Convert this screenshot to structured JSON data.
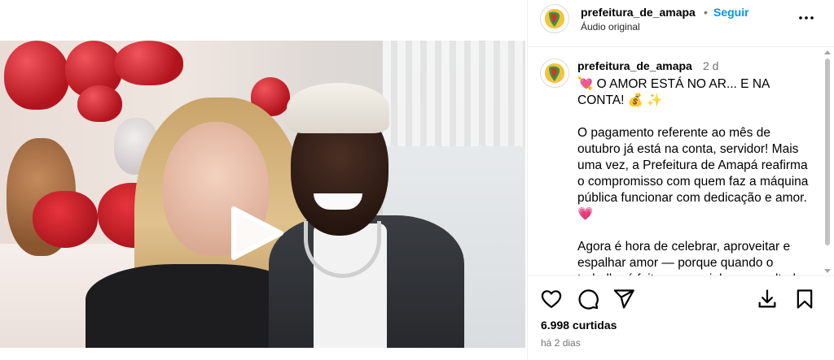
{
  "post": {
    "username": "prefeitura_de_amapa",
    "follow_label": "Seguir",
    "dot_separator": "•",
    "audio_label": "Áudio original"
  },
  "caption": {
    "username": "prefeitura_de_amapa",
    "time_ago": "2 d",
    "paragraphs": [
      "💘 O AMOR ESTÁ NO AR... E NA CONTA! 💰 ✨",
      "O pagamento referente ao mês de outubro já está na conta, servidor! Mais uma vez, a Prefeitura de Amapá reafirma o compromisso com quem faz a máquina pública funcionar com dedicação e amor. 💗",
      "Agora é hora de celebrar, aproveitar e espalhar amor — porque quando o trabalho é feito com carinho, o resultado"
    ]
  },
  "stats": {
    "likes": "6.998 curtidas",
    "posted": "há 2 dias"
  },
  "icons": {
    "more": "more-horizontal-icon",
    "like": "heart-icon",
    "comment": "comment-icon",
    "share": "send-icon",
    "save": "bookmark-icon",
    "download": "download-icon",
    "play": "play-icon",
    "mute": "speaker-muted-icon"
  },
  "colors": {
    "accent": "#0095f6",
    "secondary_text": "#737373",
    "border": "#efefef"
  }
}
